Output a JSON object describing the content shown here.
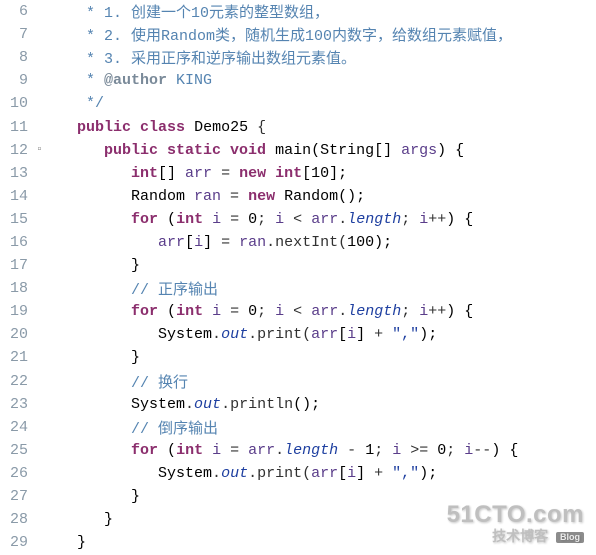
{
  "watermark": {
    "top": "51CTO.com",
    "bottom_text": "技术博客",
    "badge": "Blog"
  },
  "lines": [
    {
      "num": "6",
      "dec": "",
      "tokens": [
        [
          "c-plain",
          "    "
        ],
        [
          "c-comment",
          "* 1. 创建一个10元素的整型数组，"
        ]
      ]
    },
    {
      "num": "7",
      "dec": "",
      "tokens": [
        [
          "c-plain",
          "    "
        ],
        [
          "c-comment",
          "* 2. 使用Random类，随机生成100内数字，给数组元素赋值，"
        ]
      ]
    },
    {
      "num": "8",
      "dec": "",
      "tokens": [
        [
          "c-plain",
          "    "
        ],
        [
          "c-comment",
          "* 3. 采用正序和逆序输出数组元素值。"
        ]
      ]
    },
    {
      "num": "9",
      "dec": "",
      "tokens": [
        [
          "c-plain",
          "    "
        ],
        [
          "c-comment",
          "* "
        ],
        [
          "c-annot",
          "@author"
        ],
        [
          "c-comment",
          " KING"
        ]
      ]
    },
    {
      "num": "10",
      "dec": "",
      "tokens": [
        [
          "c-plain",
          "    "
        ],
        [
          "c-comment",
          "*/"
        ]
      ]
    },
    {
      "num": "11",
      "dec": "",
      "tokens": [
        [
          "c-plain",
          "   "
        ],
        [
          "c-keyword",
          "public class"
        ],
        [
          "c-plain",
          " "
        ],
        [
          "c-class",
          "Demo25"
        ],
        [
          "c-plain",
          " {"
        ]
      ]
    },
    {
      "num": "12",
      "dec": "▫",
      "tokens": [
        [
          "c-plain",
          "      "
        ],
        [
          "c-keyword",
          "public static void"
        ],
        [
          "c-plain",
          " "
        ],
        [
          "c-method",
          "main"
        ],
        [
          "c-paren",
          "("
        ],
        [
          "c-class",
          "String"
        ],
        [
          "c-paren",
          "[] "
        ],
        [
          "c-var",
          "args"
        ],
        [
          "c-paren",
          ") {"
        ]
      ]
    },
    {
      "num": "13",
      "dec": "",
      "tokens": [
        [
          "c-plain",
          "         "
        ],
        [
          "c-type",
          "int"
        ],
        [
          "c-paren",
          "[] "
        ],
        [
          "c-var",
          "arr"
        ],
        [
          "c-plain",
          " = "
        ],
        [
          "c-keyword",
          "new int"
        ],
        [
          "c-paren",
          "["
        ],
        [
          "c-num",
          "10"
        ],
        [
          "c-paren",
          "];"
        ]
      ]
    },
    {
      "num": "14",
      "dec": "",
      "tokens": [
        [
          "c-plain",
          "         "
        ],
        [
          "c-class",
          "Random "
        ],
        [
          "c-var",
          "ran"
        ],
        [
          "c-plain",
          " = "
        ],
        [
          "c-keyword",
          "new"
        ],
        [
          "c-plain",
          " "
        ],
        [
          "c-class",
          "Random"
        ],
        [
          "c-paren",
          "();"
        ]
      ]
    },
    {
      "num": "15",
      "dec": "",
      "tokens": [
        [
          "c-plain",
          "         "
        ],
        [
          "c-keyword",
          "for"
        ],
        [
          "c-plain",
          " "
        ],
        [
          "c-paren",
          "("
        ],
        [
          "c-type",
          "int"
        ],
        [
          "c-plain",
          " "
        ],
        [
          "c-var",
          "i"
        ],
        [
          "c-plain",
          " = "
        ],
        [
          "c-num",
          "0"
        ],
        [
          "c-plain",
          "; "
        ],
        [
          "c-var",
          "i"
        ],
        [
          "c-plain",
          " < "
        ],
        [
          "c-var",
          "arr"
        ],
        [
          "c-plain",
          "."
        ],
        [
          "c-field",
          "length"
        ],
        [
          "c-plain",
          "; "
        ],
        [
          "c-var",
          "i"
        ],
        [
          "c-plain",
          "++"
        ],
        [
          "c-paren",
          ") {"
        ]
      ]
    },
    {
      "num": "16",
      "dec": "",
      "tokens": [
        [
          "c-plain",
          "            "
        ],
        [
          "c-var",
          "arr"
        ],
        [
          "c-paren",
          "["
        ],
        [
          "c-var",
          "i"
        ],
        [
          "c-paren",
          "]"
        ],
        [
          "c-plain",
          " = "
        ],
        [
          "c-var",
          "ran"
        ],
        [
          "c-plain",
          ".nextInt("
        ],
        [
          "c-num",
          "100"
        ],
        [
          "c-paren",
          ");"
        ]
      ]
    },
    {
      "num": "17",
      "dec": "",
      "tokens": [
        [
          "c-plain",
          "         "
        ],
        [
          "c-paren",
          "}"
        ]
      ]
    },
    {
      "num": "18",
      "dec": "",
      "tokens": [
        [
          "c-plain",
          "         "
        ],
        [
          "c-comment",
          "// 正序输出"
        ]
      ]
    },
    {
      "num": "19",
      "dec": "",
      "tokens": [
        [
          "c-plain",
          "         "
        ],
        [
          "c-keyword",
          "for"
        ],
        [
          "c-plain",
          " "
        ],
        [
          "c-paren",
          "("
        ],
        [
          "c-type",
          "int"
        ],
        [
          "c-plain",
          " "
        ],
        [
          "c-var",
          "i"
        ],
        [
          "c-plain",
          " = "
        ],
        [
          "c-num",
          "0"
        ],
        [
          "c-plain",
          "; "
        ],
        [
          "c-var",
          "i"
        ],
        [
          "c-plain",
          " < "
        ],
        [
          "c-var",
          "arr"
        ],
        [
          "c-plain",
          "."
        ],
        [
          "c-field",
          "length"
        ],
        [
          "c-plain",
          "; "
        ],
        [
          "c-var",
          "i"
        ],
        [
          "c-plain",
          "++"
        ],
        [
          "c-paren",
          ") {"
        ]
      ]
    },
    {
      "num": "20",
      "dec": "",
      "tokens": [
        [
          "c-plain",
          "            "
        ],
        [
          "c-class",
          "System"
        ],
        [
          "c-plain",
          "."
        ],
        [
          "c-field",
          "out"
        ],
        [
          "c-plain",
          ".print("
        ],
        [
          "c-var",
          "arr"
        ],
        [
          "c-paren",
          "["
        ],
        [
          "c-var",
          "i"
        ],
        [
          "c-paren",
          "]"
        ],
        [
          "c-plain",
          " + "
        ],
        [
          "c-str",
          "\",\""
        ],
        [
          "c-paren",
          ");"
        ]
      ]
    },
    {
      "num": "21",
      "dec": "",
      "tokens": [
        [
          "c-plain",
          "         "
        ],
        [
          "c-paren",
          "}"
        ]
      ]
    },
    {
      "num": "22",
      "dec": "",
      "tokens": [
        [
          "c-plain",
          "         "
        ],
        [
          "c-comment",
          "// 换行"
        ]
      ]
    },
    {
      "num": "23",
      "dec": "",
      "tokens": [
        [
          "c-plain",
          "         "
        ],
        [
          "c-class",
          "System"
        ],
        [
          "c-plain",
          "."
        ],
        [
          "c-field",
          "out"
        ],
        [
          "c-plain",
          ".println"
        ],
        [
          "c-paren",
          "();"
        ]
      ]
    },
    {
      "num": "24",
      "dec": "",
      "tokens": [
        [
          "c-plain",
          "         "
        ],
        [
          "c-comment",
          "// 倒序输出"
        ]
      ]
    },
    {
      "num": "25",
      "dec": "",
      "tokens": [
        [
          "c-plain",
          "         "
        ],
        [
          "c-keyword",
          "for"
        ],
        [
          "c-plain",
          " "
        ],
        [
          "c-paren",
          "("
        ],
        [
          "c-type",
          "int"
        ],
        [
          "c-plain",
          " "
        ],
        [
          "c-var",
          "i"
        ],
        [
          "c-plain",
          " = "
        ],
        [
          "c-var",
          "arr"
        ],
        [
          "c-plain",
          "."
        ],
        [
          "c-field",
          "length"
        ],
        [
          "c-plain",
          " - "
        ],
        [
          "c-num",
          "1"
        ],
        [
          "c-plain",
          "; "
        ],
        [
          "c-var",
          "i"
        ],
        [
          "c-plain",
          " >= "
        ],
        [
          "c-num",
          "0"
        ],
        [
          "c-plain",
          "; "
        ],
        [
          "c-var",
          "i"
        ],
        [
          "c-plain",
          "--"
        ],
        [
          "c-paren",
          ") {"
        ]
      ]
    },
    {
      "num": "26",
      "dec": "",
      "tokens": [
        [
          "c-plain",
          "            "
        ],
        [
          "c-class",
          "System"
        ],
        [
          "c-plain",
          "."
        ],
        [
          "c-field",
          "out"
        ],
        [
          "c-plain",
          ".print("
        ],
        [
          "c-var",
          "arr"
        ],
        [
          "c-paren",
          "["
        ],
        [
          "c-var",
          "i"
        ],
        [
          "c-paren",
          "]"
        ],
        [
          "c-plain",
          " + "
        ],
        [
          "c-str",
          "\",\""
        ],
        [
          "c-paren",
          ");"
        ]
      ]
    },
    {
      "num": "27",
      "dec": "",
      "tokens": [
        [
          "c-plain",
          "         "
        ],
        [
          "c-paren",
          "}"
        ]
      ]
    },
    {
      "num": "28",
      "dec": "",
      "tokens": [
        [
          "c-plain",
          "      "
        ],
        [
          "c-paren",
          "}"
        ]
      ]
    },
    {
      "num": "29",
      "dec": "",
      "tokens": [
        [
          "c-plain",
          "   "
        ],
        [
          "c-paren",
          "}"
        ]
      ]
    }
  ]
}
